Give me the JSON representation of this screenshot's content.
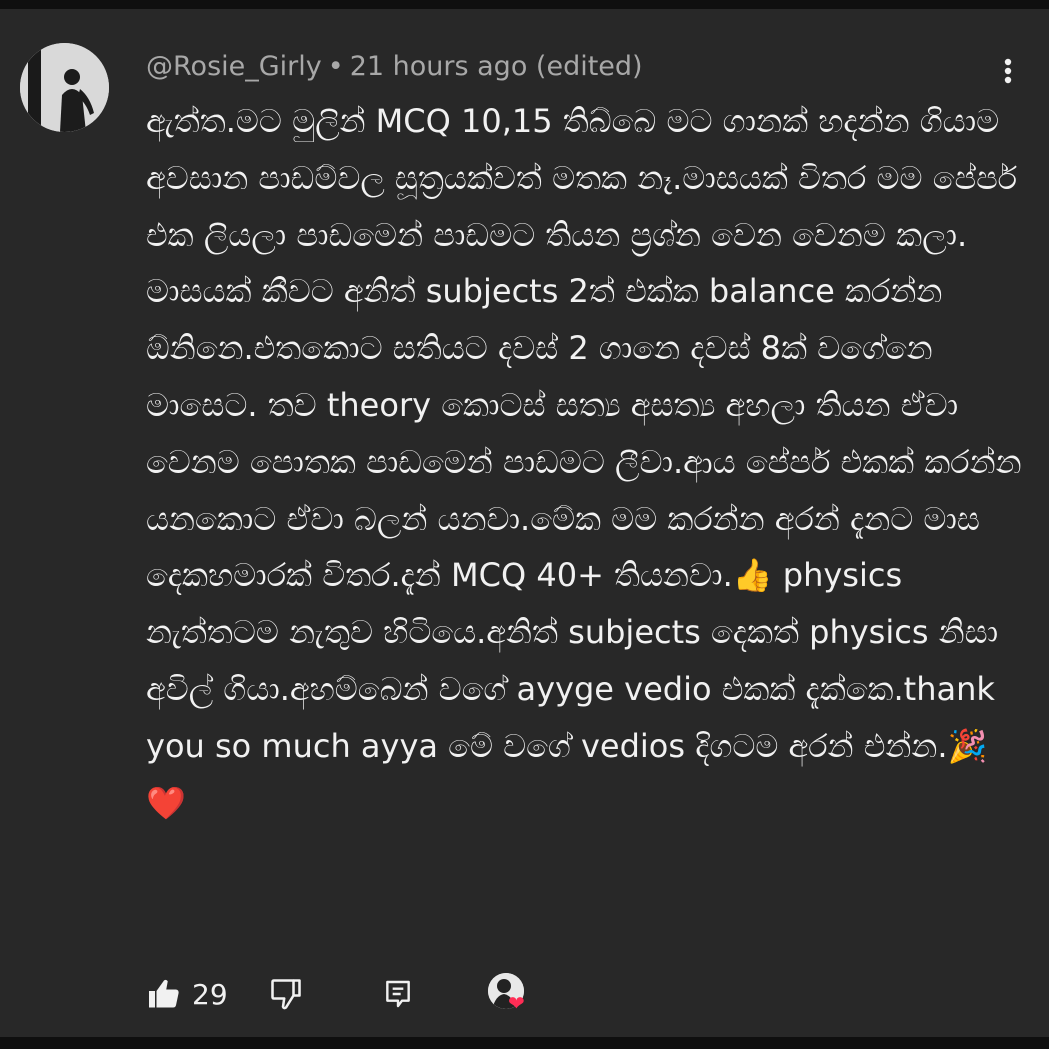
{
  "comment": {
    "author": "@Rosie_Girly",
    "separator": "•",
    "timestamp": "21 hours ago (edited)",
    "text": "ඇත්ත.මට මුලින් MCQ 10,15 තිබ්බෙ මට ගානක් හදන්න ගියාම අවසාන පාඩම්වල සූත්‍රයක්වත් මතක නෑ.මාසයක් විතර මම පේපර් එක ලියලා පාඩමෙන් පාඩමට තියන ප්‍රශ්න වෙන වෙනම කලා. මාසයක් කීවට අනිත් subjects 2ත් එක්ක balance කරන්න ඕනිනෙ.එතකොට සතියට දවස් 2 ගානෙ දවස් 8ක් වගේනෙ මාසෙට. තව theory කොටස් සත්‍ය අසත්‍ය අහලා තියන ඒවා වෙනම පොතක පාඩමෙන් පාඩමට ලීවා.ආය පේපර් එකක් කරන්න යනකොට ඒවා බලන් යනවා.මේක මම කරන්න අරන් දැනට මාස දෙකහමාරක් විතර.දැන් MCQ 40+ තියනවා.👍 physics නැත්තටම නැතුව හිටියෙ.අනිත් subjects දෙකත් physics නිසා අවිල් ගියා.අහම්බෙන් වගේ ayyge vedio එකක් දැක්කෙ.thank you so much ayya මේ වගේ vedios දිගටම අරන් එන්න.🎉❤️",
    "like_count": "29"
  },
  "icons": {
    "more": "more-vert-icon",
    "like": "thumbs-up-icon",
    "dislike": "thumbs-down-icon",
    "reply": "reply-icon",
    "heart": "creator-heart-icon"
  },
  "colors": {
    "background": "#282828",
    "text": "#f1f1f1",
    "meta": "#a8a8a8",
    "heart": "#ff2d55"
  }
}
